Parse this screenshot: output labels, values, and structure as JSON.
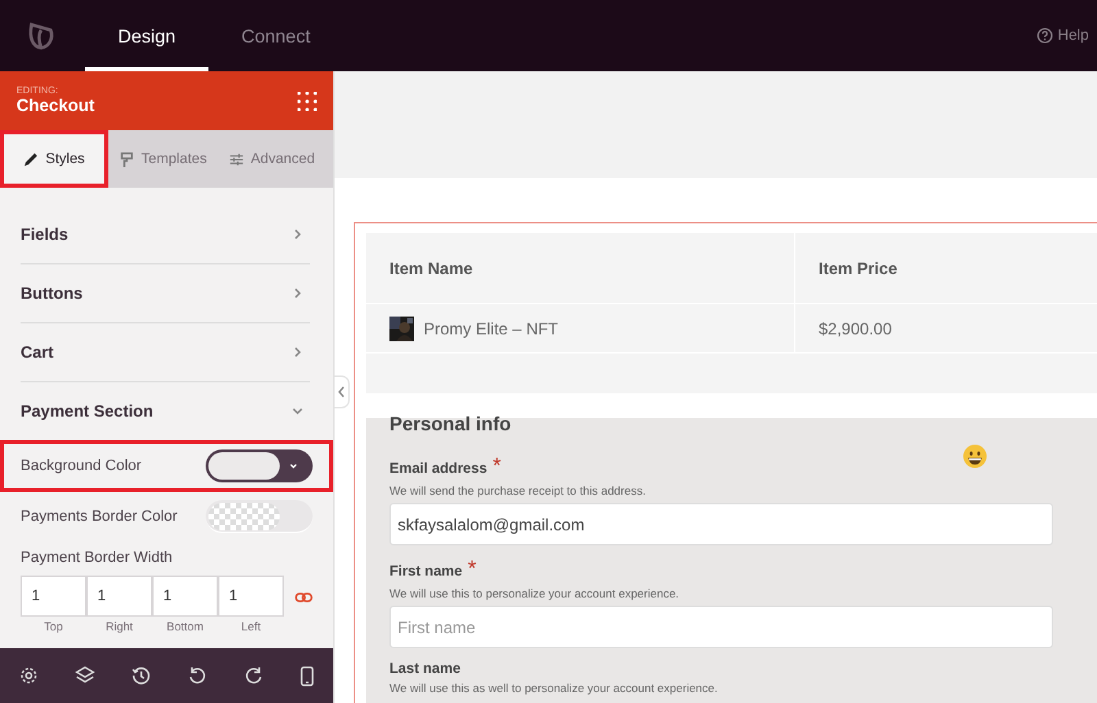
{
  "topbar": {
    "tabs": [
      {
        "label": "Design",
        "selected": true
      },
      {
        "label": "Connect",
        "selected": false
      }
    ],
    "help": "Help"
  },
  "editor": {
    "editing_label": "EDITING:",
    "title": "Checkout"
  },
  "panel_tabs": [
    {
      "label": "Styles",
      "kind": "brush",
      "selected": true,
      "highlighted": true
    },
    {
      "label": "Templates",
      "kind": "roller",
      "selected": false,
      "highlighted": false
    },
    {
      "label": "Advanced",
      "kind": "sliders",
      "selected": false,
      "highlighted": false
    }
  ],
  "sections": [
    {
      "label": "Fields",
      "expanded": false
    },
    {
      "label": "Buttons",
      "expanded": false
    },
    {
      "label": "Cart",
      "expanded": false
    },
    {
      "label": "Payment Section",
      "expanded": true
    }
  ],
  "settings": [
    {
      "kind": "color",
      "label": "Background Color",
      "highlighted": true,
      "transparent": false
    },
    {
      "kind": "color",
      "label": "Payments Border Color",
      "highlighted": false,
      "transparent": true
    }
  ],
  "border_width": {
    "label": "Payment Border Width",
    "linked": true,
    "sides": [
      {
        "value": "1",
        "label": "Top"
      },
      {
        "value": "1",
        "label": "Right"
      },
      {
        "value": "1",
        "label": "Bottom"
      },
      {
        "value": "1",
        "label": "Left"
      }
    ]
  },
  "toolbar": [
    {
      "kind": "settings"
    },
    {
      "kind": "layers"
    },
    {
      "kind": "history"
    },
    {
      "kind": "undo"
    },
    {
      "kind": "redo"
    },
    {
      "kind": "mobile"
    }
  ],
  "cart_table": {
    "columns": [
      "Item Name",
      "Item Price"
    ],
    "rows": [
      {
        "name": "Promy Elite – NFT",
        "price": "$2,900.00"
      }
    ]
  },
  "personal_info": {
    "heading": "Personal info",
    "fields": [
      {
        "label": "Email address",
        "required_mark": "*",
        "hint": "We will send the purchase receipt to this address.",
        "value": "skfaysalalom@gmail.com"
      },
      {
        "label": "First name",
        "required_mark": "*",
        "hint": "We will use this to personalize your account experience.",
        "placeholder": "First name"
      },
      {
        "label": "Last name",
        "hint": "We will use this as well to personalize your account experience."
      }
    ]
  }
}
